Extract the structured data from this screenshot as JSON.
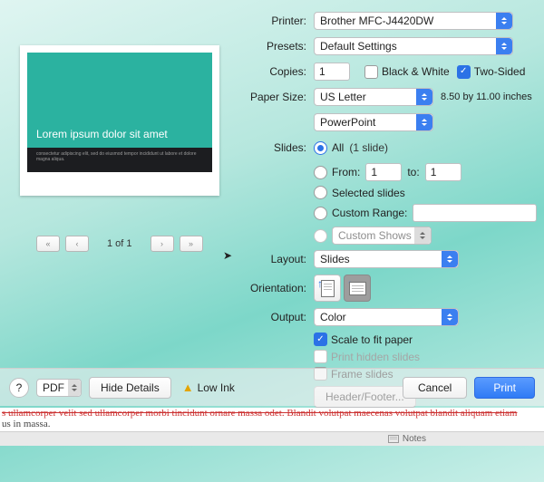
{
  "printer": {
    "label": "Printer:",
    "value": "Brother MFC-J4420DW"
  },
  "presets": {
    "label": "Presets:",
    "value": "Default Settings"
  },
  "copies": {
    "label": "Copies:",
    "value": "1",
    "bw": "Black & White",
    "two_sided": "Two-Sided"
  },
  "paper": {
    "label": "Paper Size:",
    "value": "US Letter",
    "dims": "8.50 by 11.00 inches"
  },
  "app_section": {
    "value": "PowerPoint"
  },
  "slides": {
    "label": "Slides:",
    "all": "All",
    "all_count": "(1 slide)",
    "from": "From:",
    "from_v": "1",
    "to": "to:",
    "to_v": "1",
    "selected": "Selected slides",
    "custom_range": "Custom Range:",
    "custom_shows": "Custom Shows"
  },
  "layout": {
    "label": "Layout:",
    "value": "Slides"
  },
  "orientation": {
    "label": "Orientation:"
  },
  "output": {
    "label": "Output:",
    "value": "Color"
  },
  "options": {
    "scale": "Scale to fit paper",
    "hidden": "Print hidden slides",
    "frame": "Frame slides",
    "header_footer": "Header/Footer..."
  },
  "preview": {
    "title": "Lorem ipsum dolor sit amet",
    "sub": "consectetur adipiscing elit, sed do eiusmod tempor incididunt ut labore et dolore magna aliqua.",
    "page": "1 of 1"
  },
  "footer": {
    "help": "?",
    "pdf": "PDF",
    "hide": "Hide Details",
    "warn": "Low Ink",
    "cancel": "Cancel",
    "print": "Print"
  },
  "doc": {
    "l1": "s ullamcorper velit sed ullamcorper morbi tincidunt ornare massa odet. Blandit volutpat maecenas volutpat blandit aliquam etiam",
    "l2": "us in massa."
  },
  "status": {
    "notes": "Notes"
  }
}
